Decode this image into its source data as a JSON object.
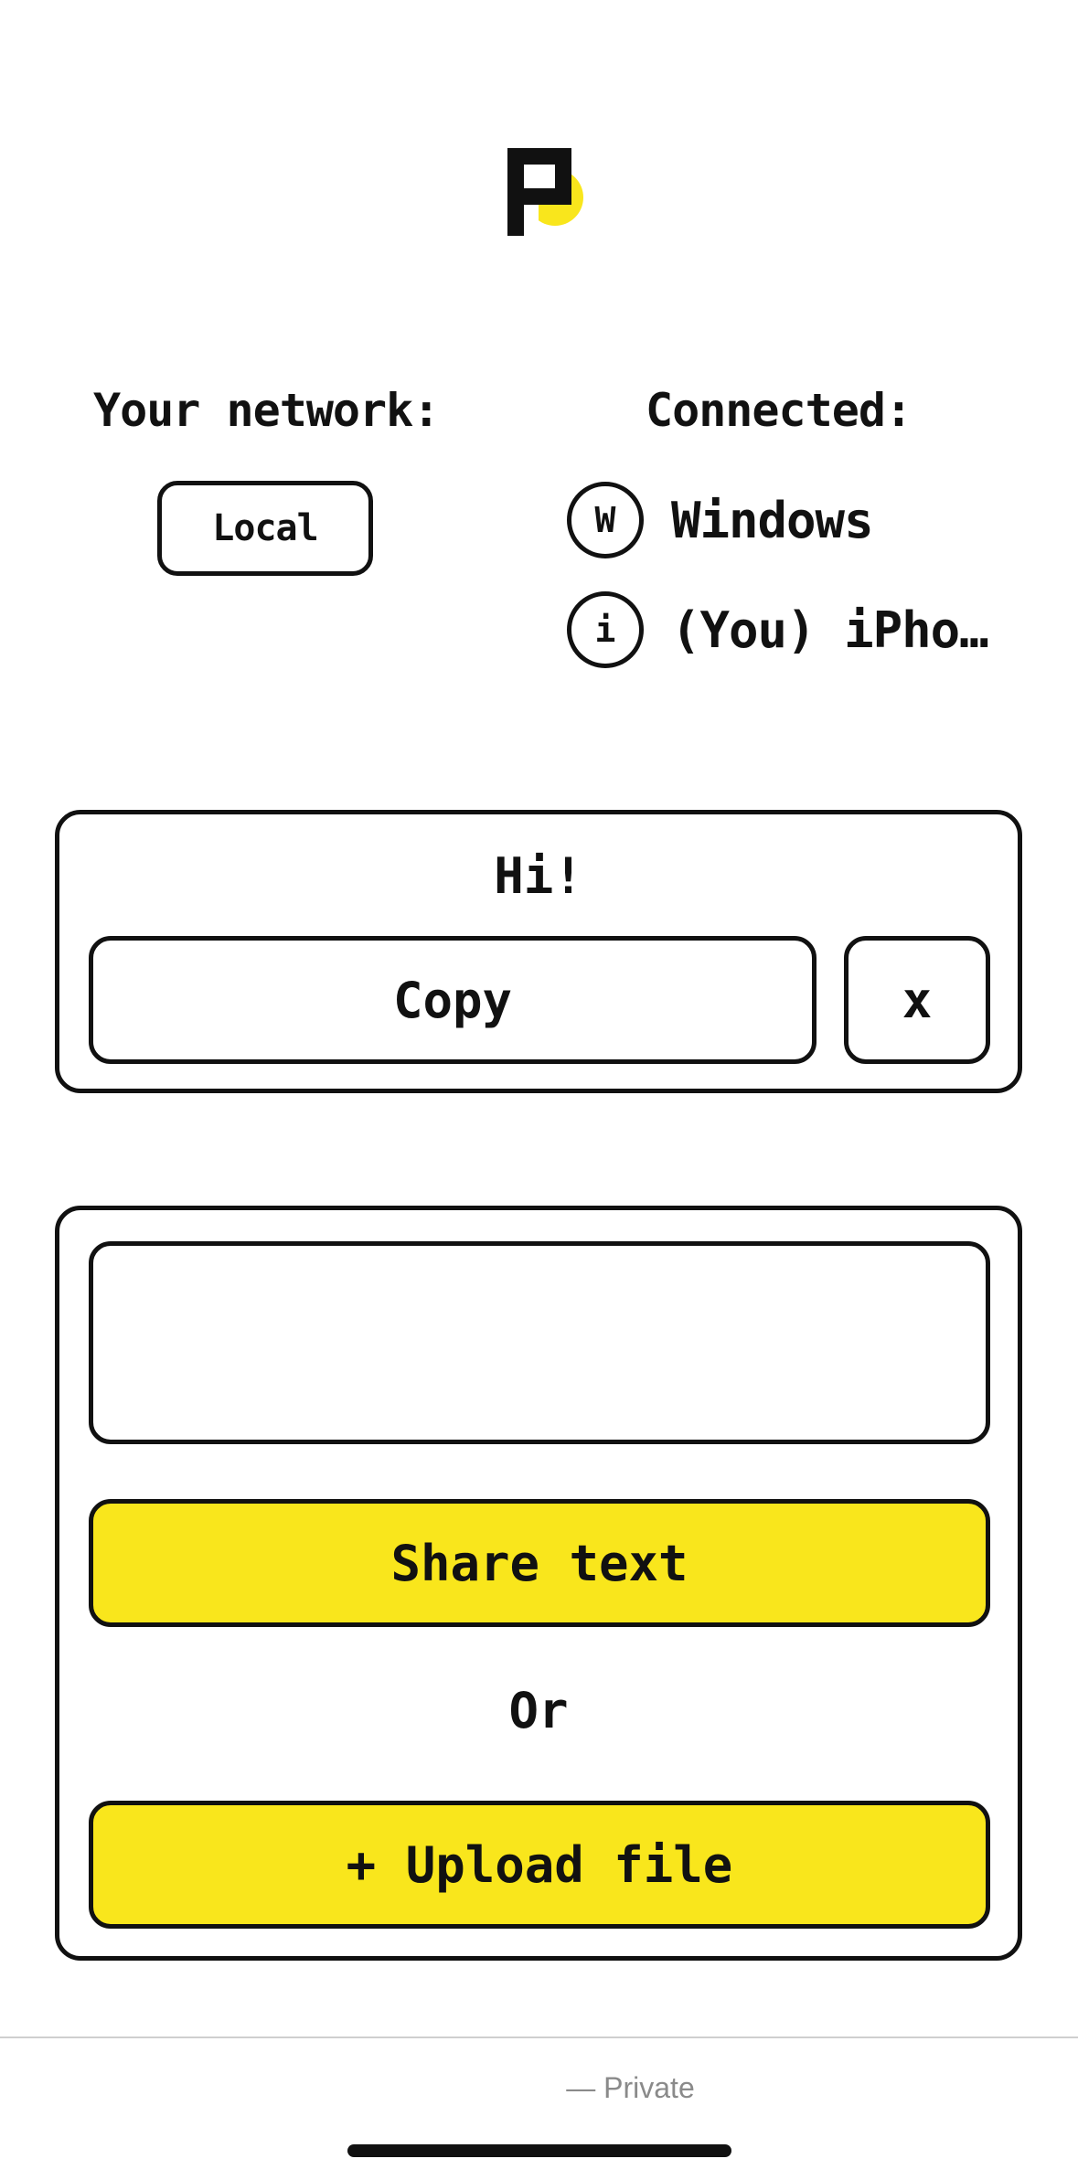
{
  "network": {
    "title": "Your network:",
    "mode_label": "Local"
  },
  "connected": {
    "title": "Connected:",
    "devices": [
      {
        "initial": "W",
        "name": "Windows"
      },
      {
        "initial": "i",
        "name": "(You) iPho…"
      }
    ]
  },
  "message_card": {
    "text": "Hi!",
    "copy_label": "Copy",
    "close_label": "x"
  },
  "share_card": {
    "input_value": "",
    "input_placeholder": "",
    "share_label": "Share text",
    "or_label": "Or",
    "upload_label": "+ Upload file"
  },
  "footer": {
    "text": "— Private"
  },
  "colors": {
    "accent": "#f9e61c",
    "ink": "#111111",
    "muted": "#8a8a8a"
  },
  "icons": {
    "logo": "app-logo"
  }
}
